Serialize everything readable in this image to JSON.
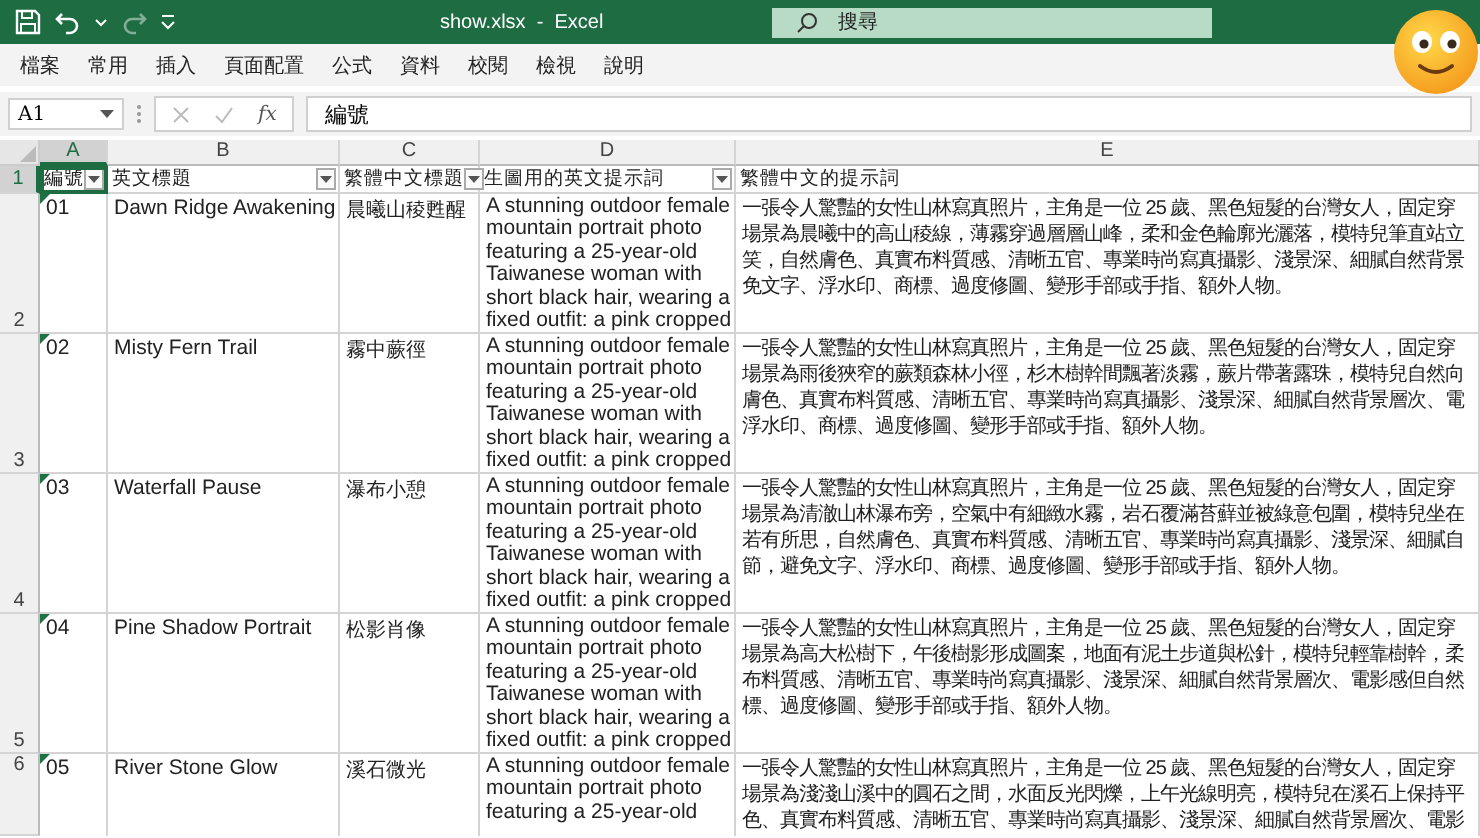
{
  "window": {
    "title": "show.xlsx  -  Excel",
    "search": {
      "placeholder": "搜尋"
    },
    "redo_disabled": true
  },
  "ribbon_tabs": [
    {
      "label": "檔案",
      "selected": false
    },
    {
      "label": "常用",
      "selected": false
    },
    {
      "label": "插入",
      "selected": false
    },
    {
      "label": "頁面配置",
      "selected": false
    },
    {
      "label": "公式",
      "selected": false
    },
    {
      "label": "資料",
      "selected": false
    },
    {
      "label": "校閱",
      "selected": false
    },
    {
      "label": "檢視",
      "selected": false
    },
    {
      "label": "說明",
      "selected": false
    }
  ],
  "formula_bar": {
    "name_box": "A1",
    "function_label": "fx",
    "value": "編號"
  },
  "columns": [
    {
      "letter": "A",
      "selected": true
    },
    {
      "letter": "B",
      "selected": false
    },
    {
      "letter": "C",
      "selected": false
    },
    {
      "letter": "D",
      "selected": false
    },
    {
      "letter": "E",
      "selected": false
    }
  ],
  "header_row": {
    "number": "1",
    "selected": true,
    "cells": [
      {
        "text": "編號",
        "filter": true,
        "selected": true
      },
      {
        "text": "英文標題",
        "filter": true,
        "selected": false
      },
      {
        "text": "繁體中文標題",
        "filter": true,
        "selected": false
      },
      {
        "text": "生圖用的英文提示詞",
        "filter": true,
        "selected": false
      },
      {
        "text": "繁體中文的提示詞",
        "filter": false,
        "selected": false
      }
    ]
  },
  "rows": [
    {
      "number": "2",
      "selected": false,
      "id": "01",
      "text_number_flag": true,
      "en_title": "Dawn Ridge Awakening",
      "zh_title": "晨曦山稜甦醒",
      "en_prompt": [
        "A stunning outdoor female",
        "mountain portrait photo",
        "featuring a 25-year-old",
        "Taiwanese woman with",
        "short black hair, wearing a",
        "fixed outfit: a pink cropped"
      ],
      "zh_prompt": [
        "一張令人驚豔的女性山林寫真照片，主角是一位 25 歲、黑色短髮的台灣女人，固定穿",
        "場景為晨曦中的高山稜線，薄霧穿過層層山峰，柔和金色輪廓光灑落，模特兒筆直站立",
        "笑，自然膚色、真實布料質感、清晰五官、專業時尚寫真攝影、淺景深、細膩自然背景",
        "免文字、浮水印、商標、過度修圖、變形手部或手指、額外人物。"
      ]
    },
    {
      "number": "3",
      "selected": false,
      "id": "02",
      "text_number_flag": true,
      "en_title": "Misty Fern Trail",
      "zh_title": "霧中蕨徑",
      "en_prompt": [
        "A stunning outdoor female",
        "mountain portrait photo",
        "featuring a 25-year-old",
        "Taiwanese woman with",
        "short black hair, wearing a",
        "fixed outfit: a pink cropped"
      ],
      "zh_prompt": [
        "一張令人驚豔的女性山林寫真照片，主角是一位 25 歲、黑色短髮的台灣女人，固定穿",
        "場景為雨後狹窄的蕨類森林小徑，杉木樹幹間飄著淡霧，蕨片帶著露珠，模特兒自然向",
        "膚色、真實布料質感、清晰五官、專業時尚寫真攝影、淺景深、細膩自然背景層次、電",
        "浮水印、商標、過度修圖、變形手部或手指、額外人物。"
      ]
    },
    {
      "number": "4",
      "selected": false,
      "id": "03",
      "text_number_flag": true,
      "en_title": "Waterfall Pause",
      "zh_title": "瀑布小憩",
      "en_prompt": [
        "A stunning outdoor female",
        "mountain portrait photo",
        "featuring a 25-year-old",
        "Taiwanese woman with",
        "short black hair, wearing a",
        "fixed outfit: a pink cropped"
      ],
      "zh_prompt": [
        "一張令人驚豔的女性山林寫真照片，主角是一位 25 歲、黑色短髮的台灣女人，固定穿",
        "場景為清澈山林瀑布旁，空氣中有細緻水霧，岩石覆滿苔蘚並被綠意包圍，模特兒坐在",
        "若有所思，自然膚色、真實布料質感、清晰五官、專業時尚寫真攝影、淺景深、細膩自",
        "節，避免文字、浮水印、商標、過度修圖、變形手部或手指、額外人物。"
      ]
    },
    {
      "number": "5",
      "selected": false,
      "id": "04",
      "text_number_flag": true,
      "en_title": "Pine Shadow Portrait",
      "zh_title": "松影肖像",
      "en_prompt": [
        "A stunning outdoor female",
        "mountain portrait photo",
        "featuring a 25-year-old",
        "Taiwanese woman with",
        "short black hair, wearing a",
        "fixed outfit: a pink cropped"
      ],
      "zh_prompt": [
        "一張令人驚豔的女性山林寫真照片，主角是一位 25 歲、黑色短髮的台灣女人，固定穿",
        "場景為高大松樹下，午後樹影形成圖案，地面有泥土步道與松針，模特兒輕靠樹幹，柔",
        "布料質感、清晰五官、專業時尚寫真攝影、淺景深、細膩自然背景層次、電影感但自然",
        "標、過度修圖、變形手部或手指、額外人物。"
      ]
    },
    {
      "number": "6",
      "selected": false,
      "id": "05",
      "text_number_flag": true,
      "en_title": "River Stone Glow",
      "zh_title": "溪石微光",
      "en_prompt": [
        "A stunning outdoor female",
        "mountain portrait photo",
        "featuring a 25-year-old"
      ],
      "zh_prompt": [
        "一張令人驚豔的女性山林寫真照片，主角是一位 25 歲、黑色短髮的台灣女人，固定穿",
        "場景為淺淺山溪中的圓石之間，水面反光閃爍，上午光線明亮，模特兒在溪石上保持平",
        "色、真實布料質感、清晰五官、專業時尚寫真攝影、淺景深、細膩自然背景層次、電影"
      ]
    }
  ]
}
